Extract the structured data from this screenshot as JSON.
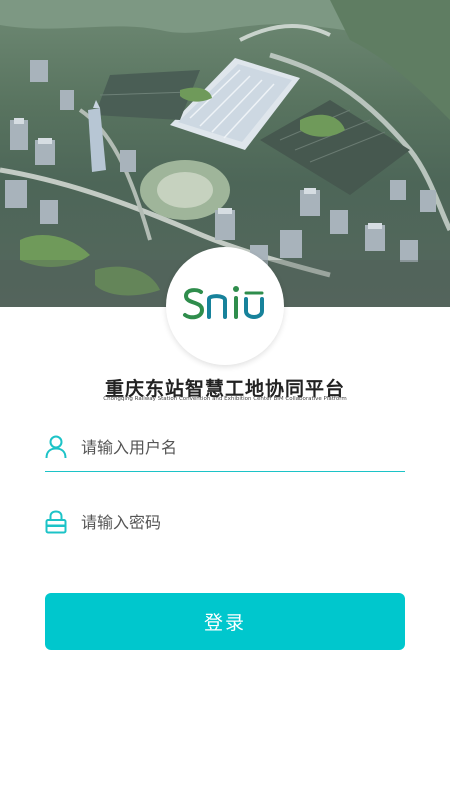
{
  "branding": {
    "logo_text": "SniU",
    "title": "重庆东站智慧工地协同平台",
    "subtitle": "Chongqing Railway Station Convention and Exhibition Center BIM Collaborative Platform"
  },
  "login_form": {
    "username_placeholder": "请输入用户名",
    "password_placeholder": "请输入密码",
    "submit_label": "登录"
  },
  "colors": {
    "accent": "#00c7cd",
    "logo_green": "#2f8d4c",
    "logo_teal": "#17829b"
  },
  "icons": {
    "username": "user-icon",
    "password": "lock-icon"
  }
}
